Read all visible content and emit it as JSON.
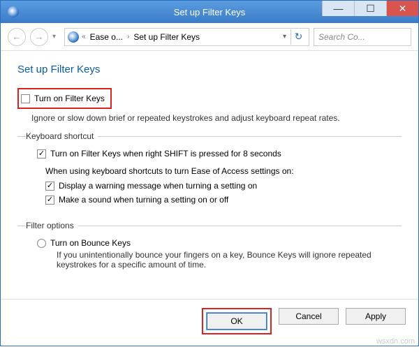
{
  "titlebar": {
    "title": "Set up Filter Keys",
    "minimize": "—",
    "maximize": "☐",
    "close": "✕"
  },
  "nav": {
    "back_glyph": "←",
    "forward_glyph": "→",
    "history_glyph": "▾",
    "refresh_glyph": "↻",
    "breadcrumb_sep1": "«",
    "breadcrumb_seg1": "Ease o...",
    "breadcrumb_sep2": "›",
    "breadcrumb_seg2": "Set up Filter Keys",
    "breadcrumb_dd": "▾",
    "search_placeholder": "Search Co..."
  },
  "page": {
    "title": "Set up Filter Keys",
    "turn_on_label": "Turn on Filter Keys",
    "turn_on_desc": "Ignore or slow down brief or repeated keystrokes and adjust keyboard repeat rates."
  },
  "shortcut": {
    "legend": "Keyboard shortcut",
    "main_label": "Turn on Filter Keys when right SHIFT is pressed for 8 seconds",
    "sub_label": "When using keyboard shortcuts to turn Ease of Access settings on:",
    "warning_label": "Display a warning message when turning a setting on",
    "sound_label": "Make a sound when turning a setting on or off"
  },
  "filter": {
    "legend": "Filter options",
    "bounce_label": "Turn on Bounce Keys",
    "bounce_desc": "If you unintentionally bounce your fingers on a key, Bounce Keys will ignore repeated keystrokes for a specific amount of time."
  },
  "buttons": {
    "ok": "OK",
    "cancel": "Cancel",
    "apply": "Apply"
  },
  "checkmark": "✓",
  "watermark": "wsxdn.com"
}
